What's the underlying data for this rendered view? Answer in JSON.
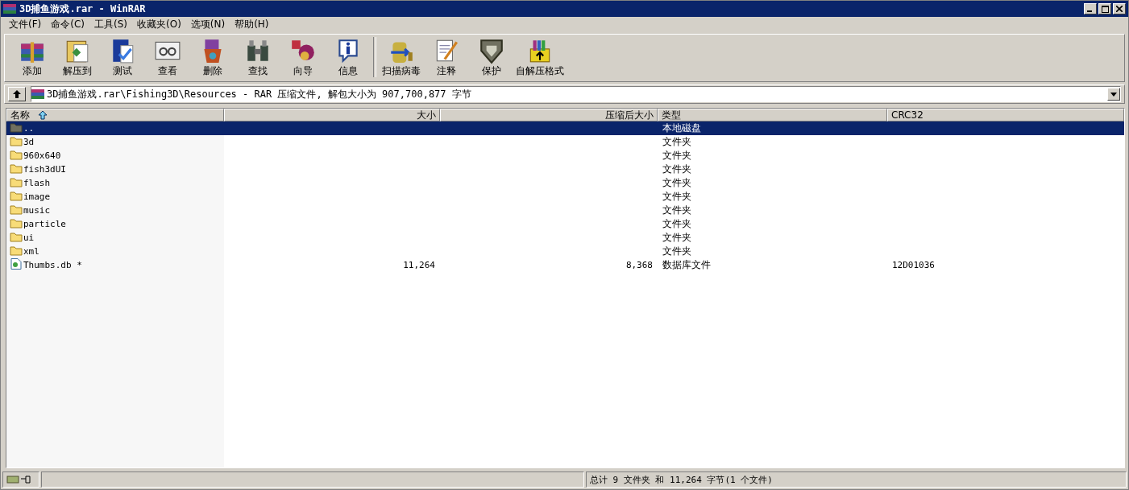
{
  "window": {
    "title": "3D捕鱼游戏.rar - WinRAR"
  },
  "menu": [
    "文件(F)",
    "命令(C)",
    "工具(S)",
    "收藏夹(O)",
    "选项(N)",
    "帮助(H)"
  ],
  "toolbar": [
    {
      "label": "添加"
    },
    {
      "label": "解压到"
    },
    {
      "label": "测试"
    },
    {
      "label": "查看"
    },
    {
      "label": "删除"
    },
    {
      "label": "查找"
    },
    {
      "label": "向导"
    },
    {
      "label": "信息"
    },
    {
      "label": "扫描病毒"
    },
    {
      "label": "注释"
    },
    {
      "label": "保护"
    },
    {
      "label": "自解压格式"
    }
  ],
  "address": {
    "value": "3D捕鱼游戏.rar\\Fishing3D\\Resources - RAR 压缩文件, 解包大小为 907,700,877 字节"
  },
  "table": {
    "columns": [
      {
        "label": "名称",
        "sorted": true
      },
      {
        "label": "大小",
        "sorted": false
      },
      {
        "label": "压缩后大小",
        "sorted": false
      },
      {
        "label": "类型",
        "sorted": false
      },
      {
        "label": "CRC32",
        "sorted": false
      }
    ],
    "rows": [
      {
        "kind": "parent",
        "name": "..",
        "size": "",
        "packed": "",
        "type": "本地磁盘",
        "crc": "",
        "selected": true
      },
      {
        "kind": "folder",
        "name": "3d",
        "size": "",
        "packed": "",
        "type": "文件夹",
        "crc": "",
        "selected": false
      },
      {
        "kind": "folder",
        "name": "960x640",
        "size": "",
        "packed": "",
        "type": "文件夹",
        "crc": "",
        "selected": false
      },
      {
        "kind": "folder",
        "name": "fish3dUI",
        "size": "",
        "packed": "",
        "type": "文件夹",
        "crc": "",
        "selected": false
      },
      {
        "kind": "folder",
        "name": "flash",
        "size": "",
        "packed": "",
        "type": "文件夹",
        "crc": "",
        "selected": false
      },
      {
        "kind": "folder",
        "name": "image",
        "size": "",
        "packed": "",
        "type": "文件夹",
        "crc": "",
        "selected": false
      },
      {
        "kind": "folder",
        "name": "music",
        "size": "",
        "packed": "",
        "type": "文件夹",
        "crc": "",
        "selected": false
      },
      {
        "kind": "folder",
        "name": "particle",
        "size": "",
        "packed": "",
        "type": "文件夹",
        "crc": "",
        "selected": false
      },
      {
        "kind": "folder",
        "name": "ui",
        "size": "",
        "packed": "",
        "type": "文件夹",
        "crc": "",
        "selected": false
      },
      {
        "kind": "folder",
        "name": "xml",
        "size": "",
        "packed": "",
        "type": "文件夹",
        "crc": "",
        "selected": false
      },
      {
        "kind": "file",
        "name": "Thumbs.db *",
        "size": "11,264",
        "packed": "8,368",
        "type": "数据库文件",
        "crc": "12D01036",
        "selected": false
      }
    ]
  },
  "status_bar": {
    "summary": "总计 9 文件夹 和 11,264 字节(1 个文件)"
  }
}
